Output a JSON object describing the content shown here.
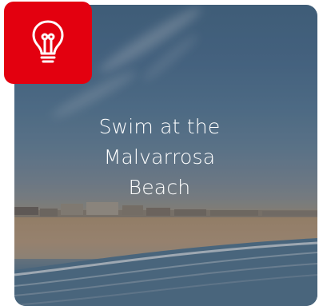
{
  "card": {
    "title_lines": [
      "Swim at the",
      "Malvarrosa",
      "Beach"
    ],
    "badge_icon": "lightbulb-icon",
    "badge_color": "#e3000f",
    "text_color": "#ffffff"
  }
}
